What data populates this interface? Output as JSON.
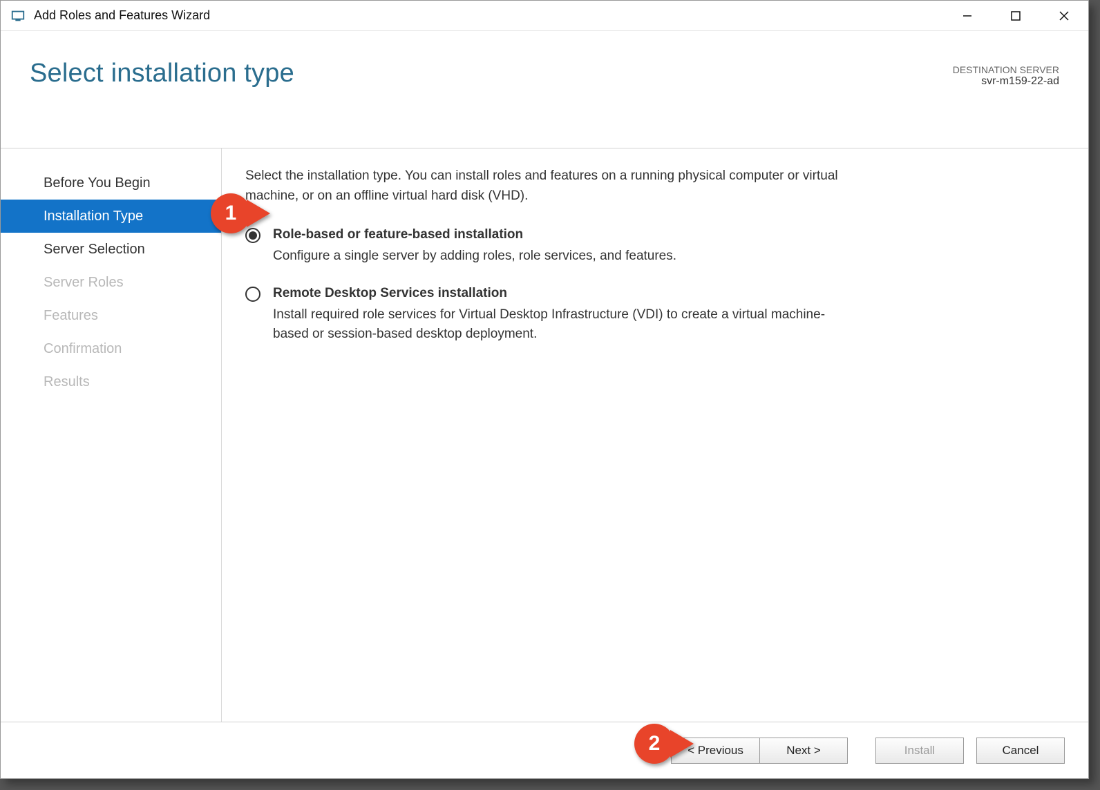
{
  "titlebar": {
    "title": "Add Roles and Features Wizard"
  },
  "header": {
    "page_title": "Select installation type",
    "dest_label": "DESTINATION SERVER",
    "dest_server": "svr-m159-22-ad"
  },
  "sidebar": {
    "steps": [
      {
        "label": "Before You Begin",
        "state": "normal"
      },
      {
        "label": "Installation Type",
        "state": "active"
      },
      {
        "label": "Server Selection",
        "state": "normal"
      },
      {
        "label": "Server Roles",
        "state": "disabled"
      },
      {
        "label": "Features",
        "state": "disabled"
      },
      {
        "label": "Confirmation",
        "state": "disabled"
      },
      {
        "label": "Results",
        "state": "disabled"
      }
    ]
  },
  "main": {
    "instruction": "Select the installation type. You can install roles and features on a running physical computer or virtual machine, or on an offline virtual hard disk (VHD).",
    "options": [
      {
        "title": "Role-based or feature-based installation",
        "desc": "Configure a single server by adding roles, role services, and features.",
        "selected": true
      },
      {
        "title": "Remote Desktop Services installation",
        "desc": "Install required role services for Virtual Desktop Infrastructure (VDI) to create a virtual machine-based or session-based desktop deployment.",
        "selected": false
      }
    ]
  },
  "footer": {
    "previous": "< Previous",
    "next": "Next >",
    "install": "Install",
    "cancel": "Cancel"
  },
  "callouts": {
    "c1": "1",
    "c2": "2"
  }
}
